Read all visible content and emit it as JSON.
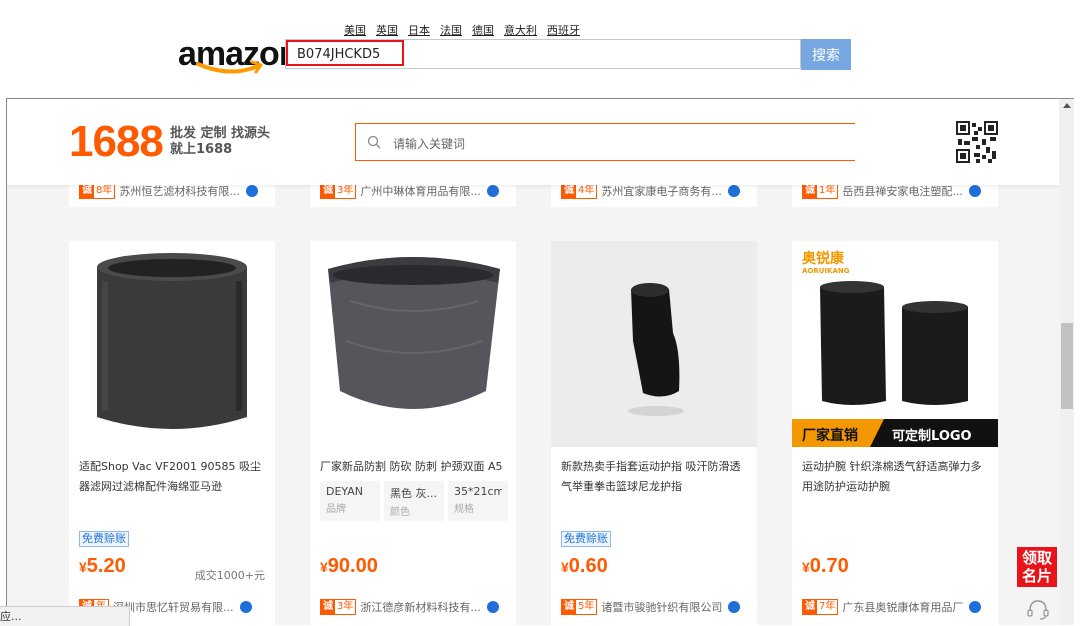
{
  "amazon": {
    "logo_text": "amazon",
    "countries": [
      "美国",
      "英国",
      "日本",
      "法国",
      "德国",
      "意大利",
      "西班牙"
    ],
    "search_value": "B074JHCKD5",
    "search_button": "搜索"
  },
  "site1688": {
    "logo": "1688",
    "slogan_line1": "批发 定制 找源头",
    "slogan_line2": "就上1688",
    "search_placeholder": "请输入关键词"
  },
  "top_suppliers": [
    {
      "years": "8年",
      "name": "苏州恒艺滤材科技有限..."
    },
    {
      "years": "3年",
      "name": "广州中琳体育用品有限..."
    },
    {
      "years": "4年",
      "name": "苏州宜家康电子商务有..."
    },
    {
      "years": "1年",
      "name": "岳西县禅安家电注塑配..."
    }
  ],
  "products": [
    {
      "title": "适配Shop Vac VF2001 90585 吸尘器滤网过滤棉配件海绵亚马逊",
      "badge": "免费赊账",
      "price": "5.20",
      "sold": "成交1000+元",
      "supplier_years": "年",
      "supplier": "深圳市思忆轩贸易有限..."
    },
    {
      "title": "厂家新品防割 防砍 防刺 护颈双面 A5",
      "attrs": [
        {
          "value": "DEYAN",
          "key": "品牌"
        },
        {
          "value": "黑色 灰...",
          "key": "颜色"
        },
        {
          "value": "35*21cm",
          "key": "规格"
        }
      ],
      "price": "90.00",
      "supplier_years": "3年",
      "supplier": "浙江德彦新材料科技有..."
    },
    {
      "title": "新款热卖手指套运动护指 吸汗防滑透气举重拳击篮球尼龙护指",
      "badge": "免费赊账",
      "price": "0.60",
      "supplier_years": "5年",
      "supplier": "诸暨市骏驰针织有限公司"
    },
    {
      "title": "运动护腕 针织涤棉透气舒适高弹力多用途防护运动护腕",
      "price": "0.70",
      "supplier_years": "7年",
      "supplier": "广东县奥锐康体育用品厂",
      "img_brand": "奥锐康",
      "img_brand_en": "AORUIKANG",
      "img_tag_left": "厂家直销",
      "img_tag_right": "可定制LOGO"
    }
  ],
  "currency": "¥",
  "year_icon": "诚",
  "side_card": "领取名片",
  "status_text": "应..."
}
